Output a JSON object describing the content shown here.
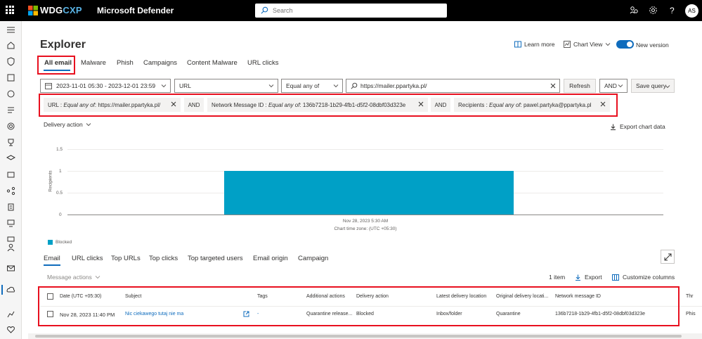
{
  "topbar": {
    "brand_a": "WDG",
    "brand_b": "CXP",
    "product": "Microsoft Defender",
    "search_placeholder": "Search",
    "avatar": "AS"
  },
  "page": {
    "title": "Explorer",
    "learn_more": "Learn more",
    "chart_view": "Chart View",
    "new_version": "New version"
  },
  "tabs": [
    "All email",
    "Malware",
    "Phish",
    "Campaigns",
    "Content Malware",
    "URL clicks"
  ],
  "filters": {
    "date_range": "2023-11-01 05:30 - 2023-12-01 23:59",
    "field": "URL",
    "operator": "Equal any of",
    "value": "https://mailer.ppartyka.pl/",
    "refresh": "Refresh",
    "logic": "AND",
    "save_query": "Save query"
  },
  "pills": {
    "p1_key": "URL : ",
    "p1_op": "Equal any of",
    "p1_val": " : https://mailer.ppartyka.pl/",
    "and1": "AND",
    "p2_key": "Network Message ID : ",
    "p2_op": "Equal any of",
    "p2_val": " : 136b7218-1b29-4fb1-d5f2-08dbf03d323e",
    "and2": "AND",
    "p3_key": "Recipients : ",
    "p3_op": "Equal any of",
    "p3_val": " : pawel.partyka@ppartyka.pl"
  },
  "chart_header": {
    "dropdown": "Delivery action",
    "export": "Export chart data"
  },
  "chart_data": {
    "type": "bar",
    "categories": [
      "Nov 28, 2023 5:30 AM"
    ],
    "series": [
      {
        "name": "Blocked",
        "values": [
          1
        ]
      }
    ],
    "ylabel": "Recipients",
    "xlabel": "Chart time zone: (UTC +05:30)",
    "y_ticks": [
      "0",
      "0.5",
      "1",
      "1.5"
    ],
    "ylim": [
      0,
      1.5
    ],
    "legend": "bottom-left",
    "colors": {
      "Blocked": "#00a0c6"
    }
  },
  "subtabs": [
    "Email",
    "URL clicks",
    "Top URLs",
    "Top clicks",
    "Top targeted users",
    "Email origin",
    "Campaign"
  ],
  "table_toolbar": {
    "message_actions": "Message actions",
    "count": "1 item",
    "export": "Export",
    "customize": "Customize columns"
  },
  "table": {
    "headers": [
      "Date (UTC +05:30)",
      "Subject",
      "Tags",
      "Additional actions",
      "Delivery action",
      "Latest delivery location",
      "Original delivery locati...",
      "Network message ID",
      "Thr"
    ],
    "row": [
      "Nov 28, 2023 11:40 PM",
      "Nic ciekawego tutaj nie ma",
      "-",
      "Quarantine release...",
      "Blocked",
      "Inbox/folder",
      "Quarantine",
      "136b7218-1b29-4fb1-d5f2-08dbf03d323e",
      "Phis"
    ]
  },
  "colors": {
    "accent": "#0f6cbd",
    "highlight": "#e8101f",
    "bar": "#00a0c6"
  }
}
